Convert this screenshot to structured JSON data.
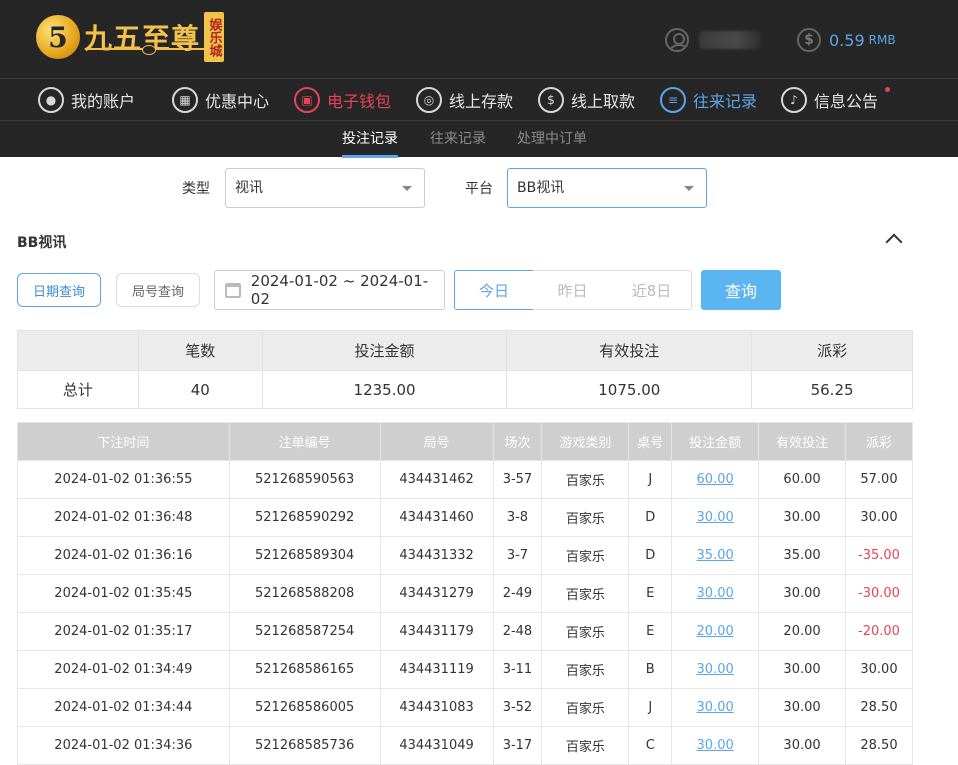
{
  "header": {
    "logo_mark": "5",
    "logo_text": "九五至尊",
    "logo_badge": "娱乐城",
    "balance_value": "0.59",
    "balance_unit": "RMB"
  },
  "nav": {
    "items": [
      {
        "label": "我的账户"
      },
      {
        "label": "优惠中心"
      },
      {
        "label": "电子钱包"
      },
      {
        "label": "线上存款"
      },
      {
        "label": "线上取款"
      },
      {
        "label": "往来记录"
      },
      {
        "label": "信息公告"
      }
    ]
  },
  "subtabs": [
    {
      "label": "投注记录"
    },
    {
      "label": "往来记录"
    },
    {
      "label": "处理中订单"
    }
  ],
  "filters": {
    "type_label": "类型",
    "type_value": "视讯",
    "platform_label": "平台",
    "platform_value": "BB视讯"
  },
  "section_title": "BB视讯",
  "query": {
    "date_mode": "日期查询",
    "round_mode": "局号查询",
    "date_range": "2024-01-02 ~ 2024-01-02",
    "today": "今日",
    "yesterday": "昨日",
    "last8": "近8日",
    "submit": "查询"
  },
  "summary": {
    "headers": [
      "",
      "笔数",
      "投注金额",
      "有效投注",
      "派彩"
    ],
    "row": [
      "总计",
      "40",
      "1235.00",
      "1075.00",
      "56.25"
    ]
  },
  "table": {
    "headers": [
      "下注时间",
      "注单编号",
      "局号",
      "场次",
      "游戏类别",
      "桌号",
      "投注金额",
      "有效投注",
      "派彩"
    ],
    "rows": [
      [
        "2024-01-02 01:36:55",
        "521268590563",
        "434431462",
        "3-57",
        "百家乐",
        "J",
        "60.00",
        "60.00",
        "57.00"
      ],
      [
        "2024-01-02 01:36:48",
        "521268590292",
        "434431460",
        "3-8",
        "百家乐",
        "D",
        "30.00",
        "30.00",
        "30.00"
      ],
      [
        "2024-01-02 01:36:16",
        "521268589304",
        "434431332",
        "3-7",
        "百家乐",
        "D",
        "35.00",
        "35.00",
        "-35.00"
      ],
      [
        "2024-01-02 01:35:45",
        "521268588208",
        "434431279",
        "2-49",
        "百家乐",
        "E",
        "30.00",
        "30.00",
        "-30.00"
      ],
      [
        "2024-01-02 01:35:17",
        "521268587254",
        "434431179",
        "2-48",
        "百家乐",
        "E",
        "20.00",
        "20.00",
        "-20.00"
      ],
      [
        "2024-01-02 01:34:49",
        "521268586165",
        "434431119",
        "3-11",
        "百家乐",
        "B",
        "30.00",
        "30.00",
        "30.00"
      ],
      [
        "2024-01-02 01:34:44",
        "521268586005",
        "434431083",
        "3-52",
        "百家乐",
        "J",
        "30.00",
        "30.00",
        "28.50"
      ],
      [
        "2024-01-02 01:34:36",
        "521268585736",
        "434431049",
        "3-17",
        "百家乐",
        "C",
        "30.00",
        "30.00",
        "28.50"
      ]
    ]
  },
  "colors": {
    "accent_blue": "#5aa6e8",
    "accent_red": "#e8435a",
    "gold": "#f2c24a",
    "header_bg": "#262626"
  }
}
